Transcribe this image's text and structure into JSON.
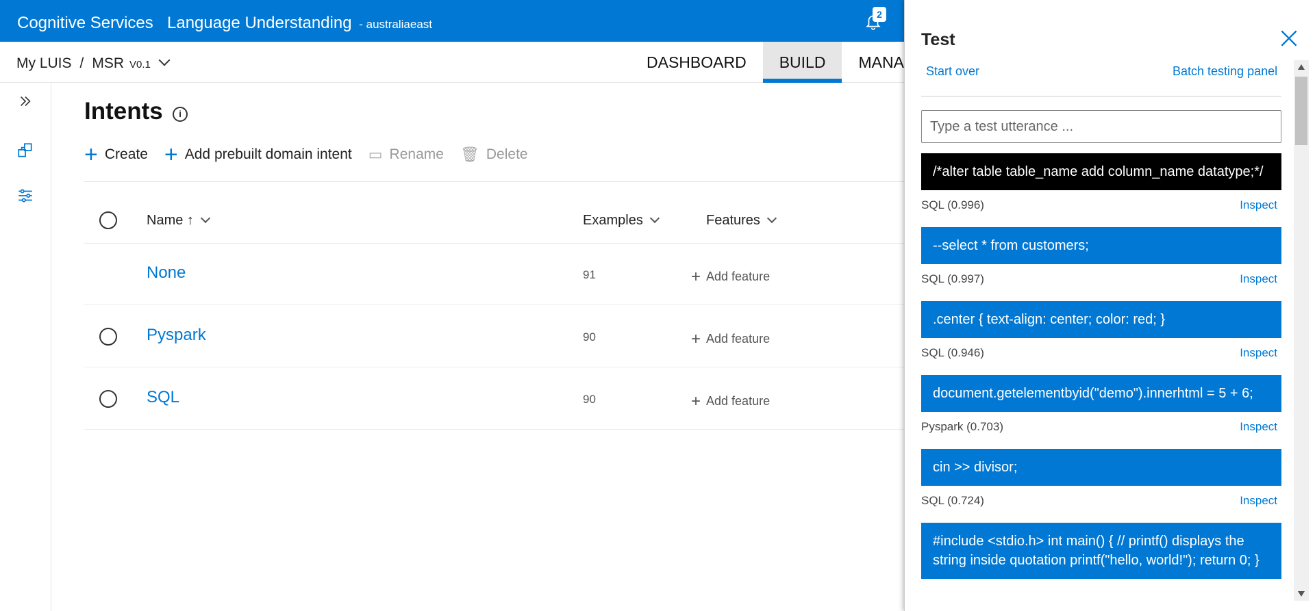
{
  "header": {
    "brand": "Cognitive Services",
    "product": "Language Understanding",
    "region": "- australiaeast",
    "notification_count": "2"
  },
  "breadcrumb": {
    "root": "My LUIS",
    "separator": "/",
    "app": "MSR",
    "version": "V0.1"
  },
  "nav": {
    "tabs": [
      {
        "label": "DASHBOARD",
        "active": false
      },
      {
        "label": "BUILD",
        "active": true
      },
      {
        "label": "MANAGE",
        "active": false
      }
    ]
  },
  "page": {
    "title": "Intents"
  },
  "commands": {
    "create": "Create",
    "add_prebuilt": "Add prebuilt domain intent",
    "rename": "Rename",
    "delete": "Delete"
  },
  "table": {
    "columns": {
      "name": "Name ↑",
      "examples": "Examples",
      "features": "Features"
    },
    "rows": [
      {
        "name": "None",
        "examples": "91",
        "feature_action": "Add feature"
      },
      {
        "name": "Pyspark",
        "examples": "90",
        "feature_action": "Add feature"
      },
      {
        "name": "SQL",
        "examples": "90",
        "feature_action": "Add feature"
      }
    ]
  },
  "test_panel": {
    "title": "Test",
    "start_over": "Start over",
    "batch_testing": "Batch testing panel",
    "input_placeholder": "Type a test utterance ...",
    "results": [
      {
        "utterance": "/*alter table table_name add column_name datatype;*/",
        "prediction": "SQL (0.996)",
        "inspect": "Inspect",
        "selected": true
      },
      {
        "utterance": "--select * from customers;",
        "prediction": "SQL (0.997)",
        "inspect": "Inspect",
        "selected": false
      },
      {
        "utterance": ".center { text-align: center; color: red; }",
        "prediction": "SQL (0.946)",
        "inspect": "Inspect",
        "selected": false
      },
      {
        "utterance": "document.getelementbyid(\"demo\").innerhtml = 5 + 6;",
        "prediction": "Pyspark (0.703)",
        "inspect": "Inspect",
        "selected": false
      },
      {
        "utterance": "cin >> divisor;",
        "prediction": "SQL (0.724)",
        "inspect": "Inspect",
        "selected": false
      },
      {
        "utterance": "#include <stdio.h> int main() { // printf() displays the string inside quotation printf(\"hello, world!\"); return 0; }",
        "prediction": "",
        "inspect": "",
        "selected": false
      }
    ]
  },
  "colors": {
    "accent": "#0078d4",
    "selected_utterance": "#000000"
  }
}
